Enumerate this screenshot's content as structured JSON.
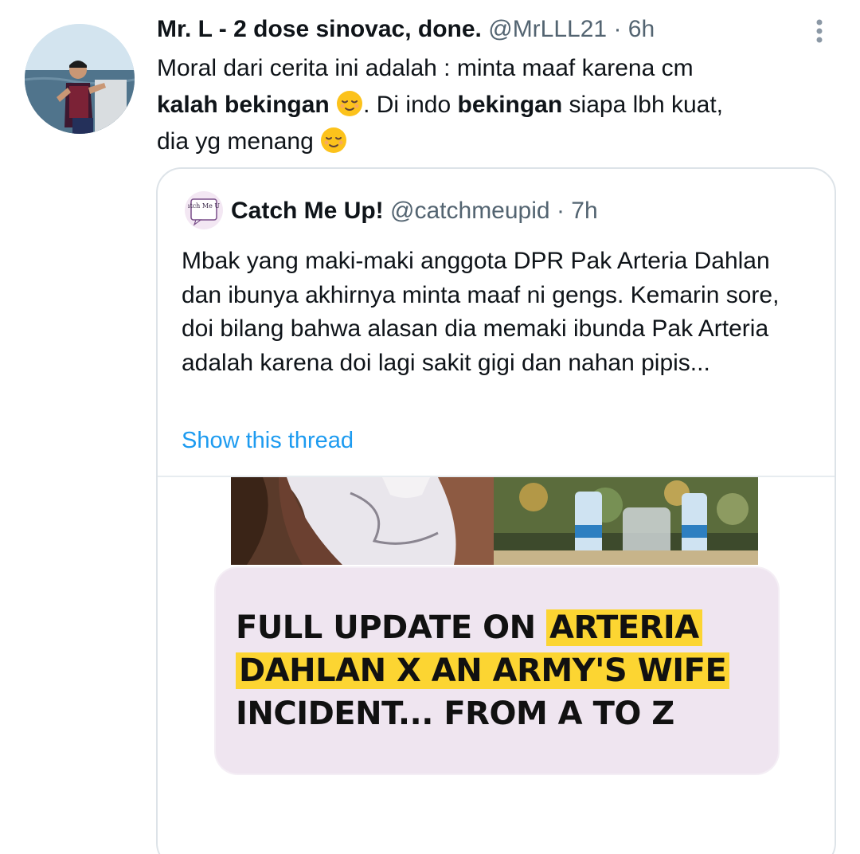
{
  "tweet": {
    "author_name": "Mr. L - 2 dose sinovac, done.",
    "handle": "@MrLLL21",
    "separator": "·",
    "time": "6h",
    "text_1": "Moral dari cerita ini adalah : minta maaf karena cm",
    "text_bold_1": "kalah bekingan",
    "text_2": ". Di indo",
    "text_bold_2": "bekingan",
    "text_3": "siapa lbh kuat,",
    "text_4": "dia yg menang",
    "emoji": "relieved-face"
  },
  "quote": {
    "author_name": "Catch Me Up!",
    "handle": "@catchmeupid",
    "separator": "·",
    "time": "7h",
    "avatar_text": "Catch Me Up!",
    "text": "Mbak yang maki-maki anggota DPR Pak Arteria Dahlan dan ibunya akhirnya minta maaf ni gengs. Kemarin sore, doi bilang bahwa alasan dia memaki ibunda Pak Arteria adalah karena doi lagi sakit gigi dan nahan pipis...",
    "show_thread": "Show this thread",
    "card": {
      "line_1a": "FULL UPDATE ON",
      "line_1b": "ARTERIA",
      "line_2": "DAHLAN X AN ARMY'S WIFE",
      "line_3": "INCIDENT... FROM A TO Z"
    }
  },
  "colors": {
    "text": "#0f1419",
    "secondary": "#536471",
    "link": "#1d9bf0",
    "highlight": "#fcd532",
    "card_bg": "#efe5f0"
  }
}
